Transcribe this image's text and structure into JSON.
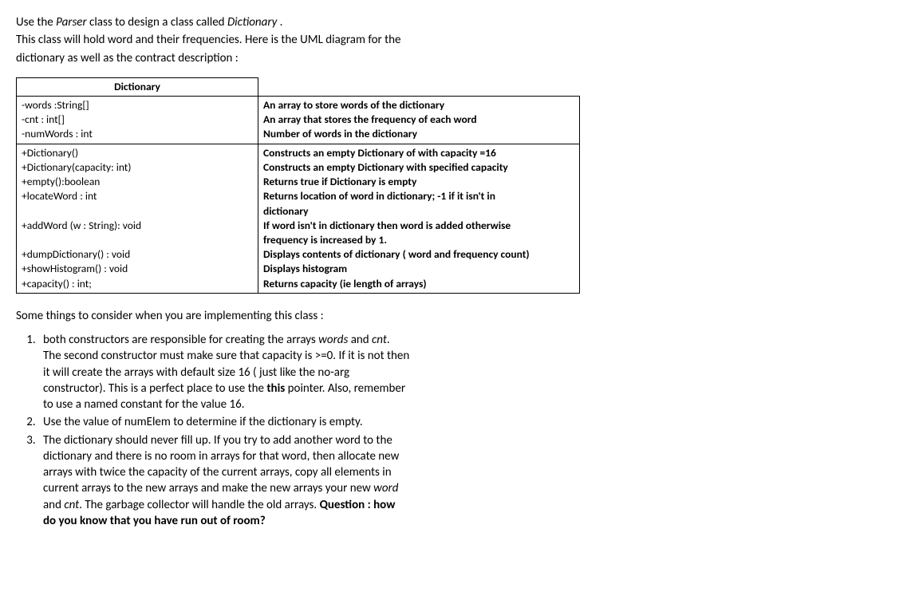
{
  "intro": {
    "line1a": "Use the ",
    "line1b": "Parser",
    "line1c": " class to design a class called ",
    "line1d": "Dictionary",
    "line1e": " .",
    "line2": "This class will hold word and their frequencies. Here is the UML diagram for the",
    "line3": "dictionary as well as the contract description :"
  },
  "uml": {
    "title": "Dictionary",
    "attrs": {
      "a1": "-words :String[]",
      "a2": "-cnt : int[]",
      "a3": "-numWords : int",
      "d1": "An array to store words of the dictionary",
      "d2": "An array that stores the frequency of each word",
      "d3": "Number of words in the dictionary"
    },
    "methods": {
      "m1": "+Dictionary()",
      "m2": "+Dictionary(capacity: int)",
      "m3": "+empty():boolean",
      "m4": "+locateWord : int",
      "m5blank": "",
      "m6": "+addWord (w : String): void",
      "m7blank": "",
      "m8": "+dumpDictionary() : void",
      "m9": "+showHistogram() : void",
      "m10": "+capacity() : int;",
      "e1": "Constructs an empty Dictionary of with capacity =16",
      "e2": "Constructs an empty Dictionary with specified capacity",
      "e3": "Returns true if Dictionary is empty",
      "e4": "Returns location of word in dictionary; -1 if it isn't in",
      "e5": "dictionary",
      "e6": "If word isn't in dictionary then  word is added otherwise",
      "e7": "frequency is increased by 1.",
      "e8": "Displays contents of dictionary ( word and frequency count)",
      "e9": "Displays histogram",
      "e10": "Returns capacity (ie length of arrays)"
    }
  },
  "consider": "Some things to consider when you are implementing this class :",
  "list": {
    "i1": {
      "a": "both constructors are responsible for creating the arrays ",
      "b": "words",
      "c": " and ",
      "d": "cnt",
      "e": ".",
      "l2": "The second constructor must make sure that capacity is >=0. If it is not then",
      "l3": "it will create the arrays with default size 16 ( just like the no-arg",
      "l4a": "constructor). This is a perfect place to use the ",
      "l4b": "this",
      "l4c": " pointer. Also, remember",
      "l5": "to use a named constant for the value 16."
    },
    "i2": "Use the value of numElem to determine if the dictionary is empty.",
    "i3": {
      "l1": "The dictionary should never fill up. If you try to add another word to the",
      "l2": "dictionary and there is no room in arrays for that word, then allocate new",
      "l3": "arrays with  twice the capacity of the current arrays, copy all elements in",
      "l4a": "current arrays to the new arrays and make the new arrays your new ",
      "l4b": "word",
      "l5a": "and ",
      "l5b": "cnt",
      "l5c": ". The garbage collector will handle the old  arrays. ",
      "l5d": "Question : how",
      "l6": "do you know that you have run out of room?"
    }
  }
}
